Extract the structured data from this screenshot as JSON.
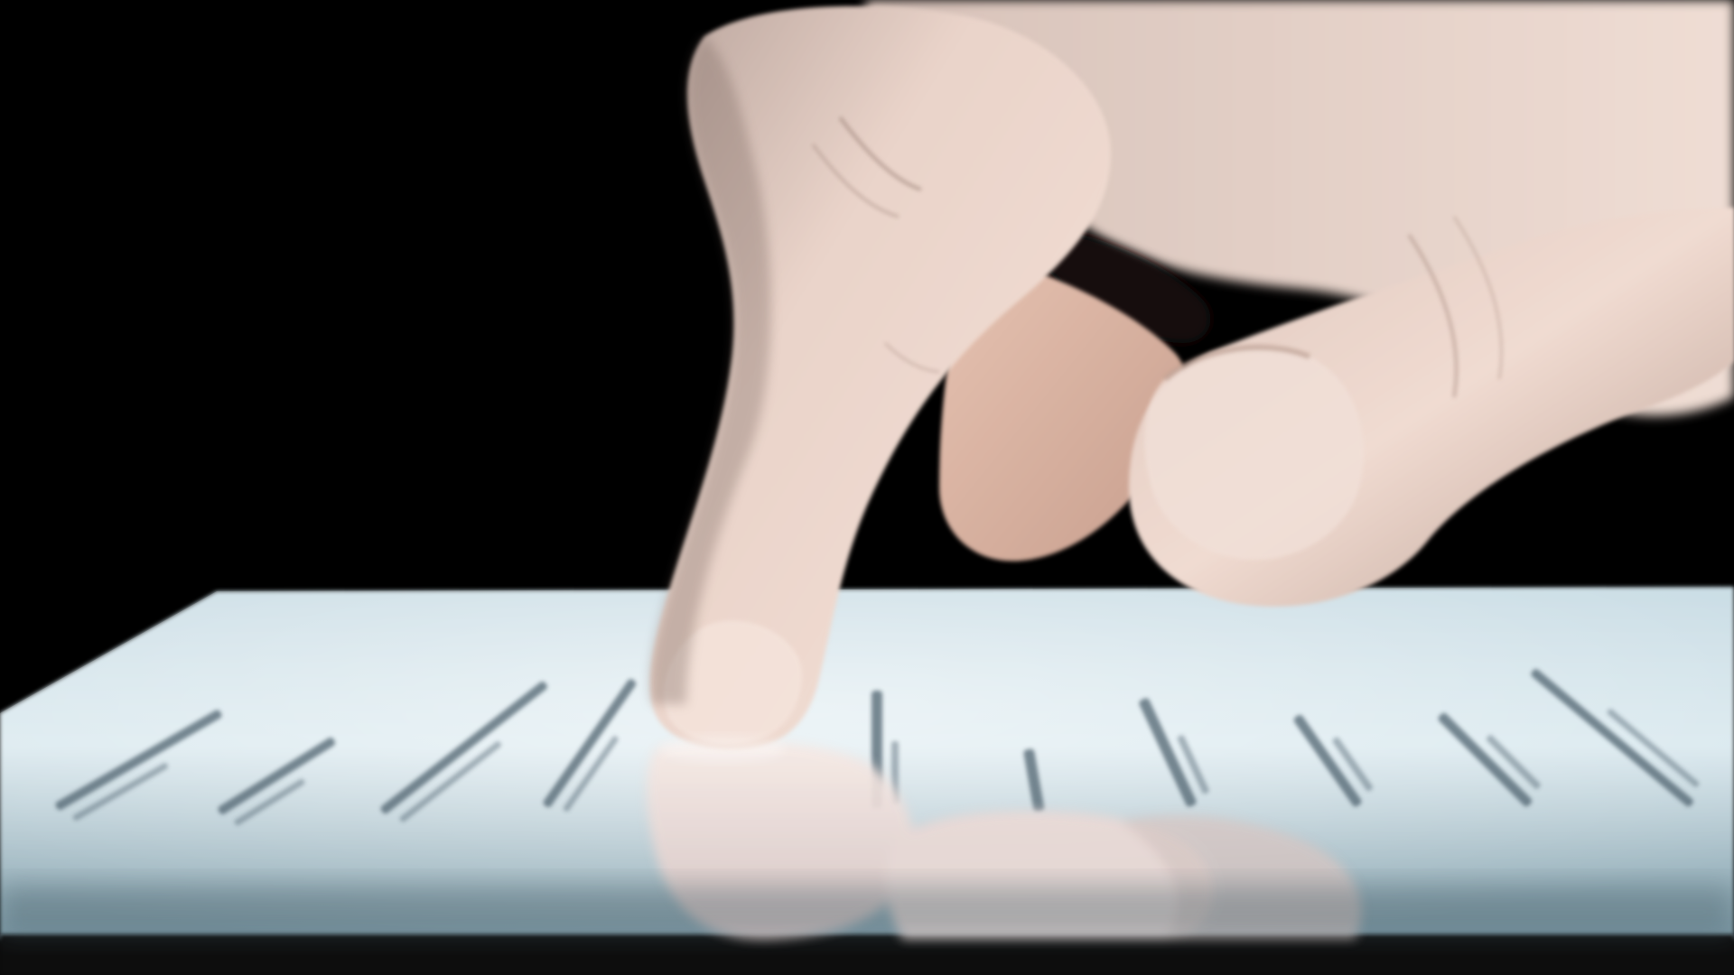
{
  "scene": {
    "subject": "hand-touching-backlit-screen",
    "colors": {
      "background": "#000000",
      "screen_light": "#d9e8ee",
      "screen_mid": "#a9c4cf",
      "screen_dark": "#5f7d89",
      "skin_light": "#f3ddd3",
      "skin_mid": "#dcbcae",
      "skin_shadow": "#8a6f66",
      "text_mark": "#4f6470"
    },
    "blurred_text_lines": 12
  }
}
